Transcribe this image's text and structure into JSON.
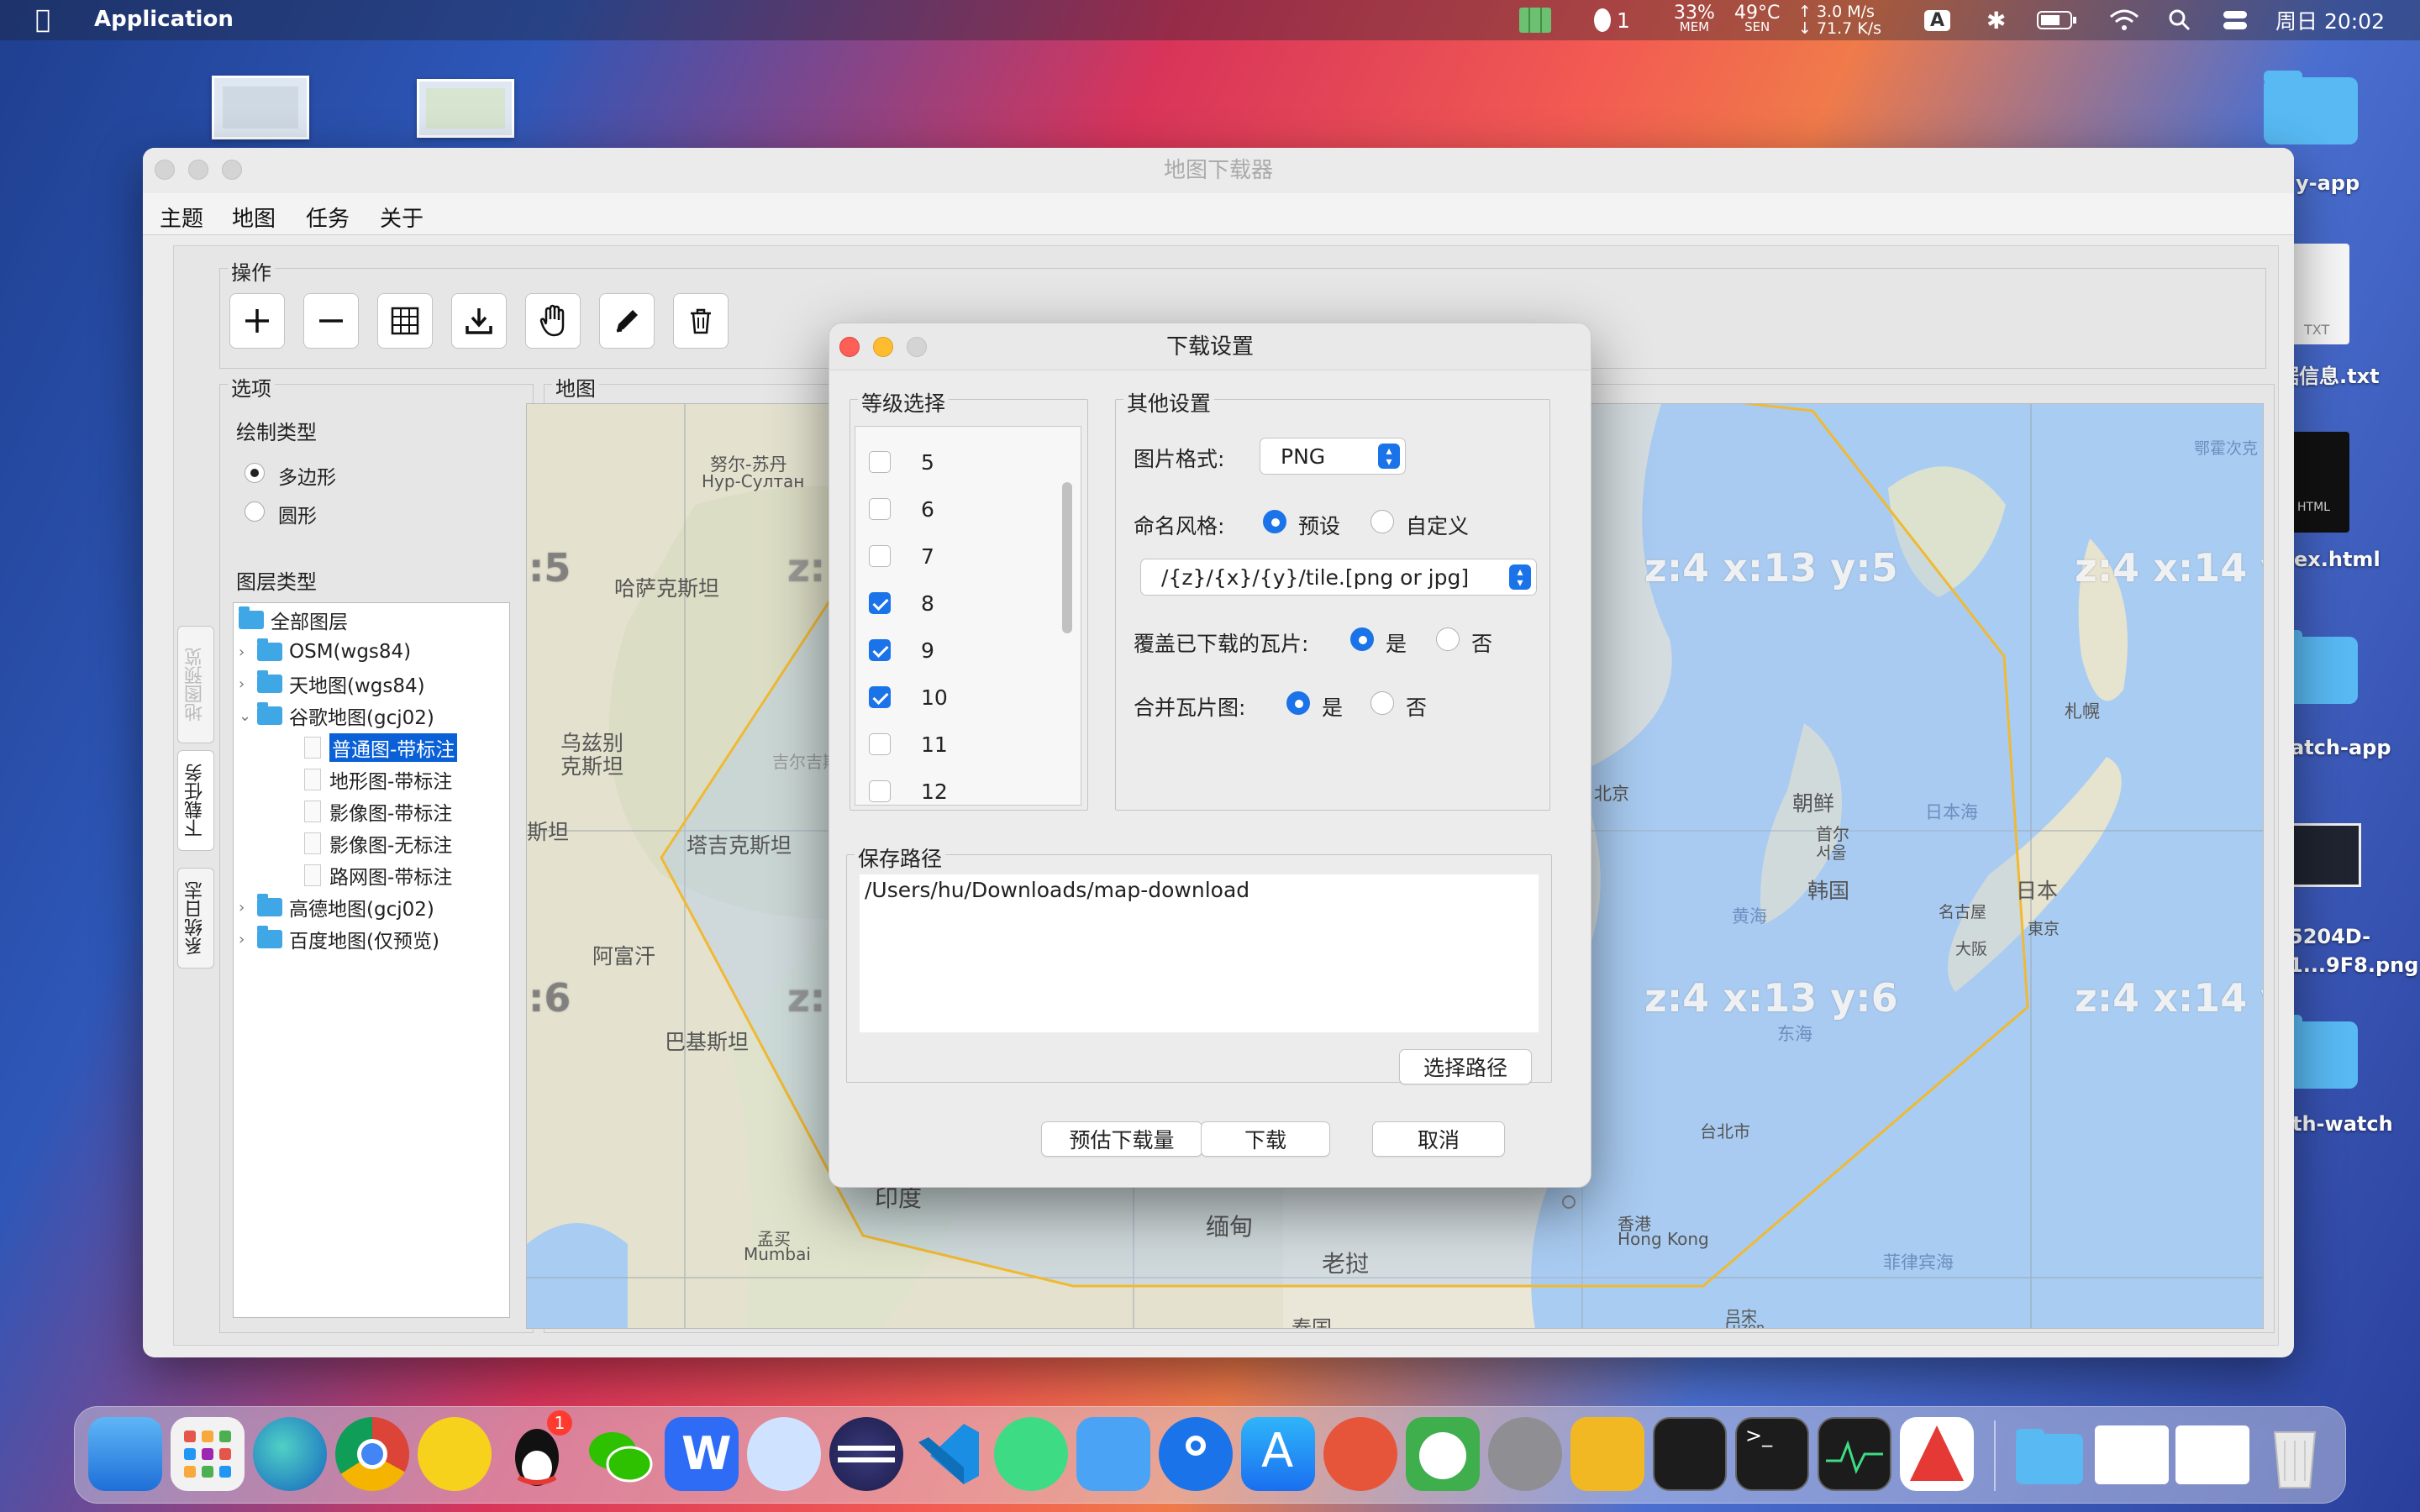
{
  "menubar": {
    "app_name": "Application",
    "mem": "33%",
    "mem_label": "MEM",
    "temp": "49°C",
    "temp_label": "SEN",
    "net_up": "3.0 M/s",
    "net_down": "71.7 K/s",
    "qq_count": "1",
    "input_method": "A",
    "clock": "周日 20:02"
  },
  "desktop": {
    "items": [
      {
        "label": "y-app"
      },
      {
        "label": "据信息.txt",
        "badge": "TXT"
      },
      {
        "label": "ex.html",
        "badge": "HTML"
      },
      {
        "label": "atch-app"
      },
      {
        "label": "5204D-\n1...9F8.png"
      },
      {
        "label": "th-watch"
      }
    ]
  },
  "window": {
    "title": "地图下载器",
    "menu": [
      "主题",
      "地图",
      "任务",
      "关于"
    ],
    "ops_label": "操作",
    "options_label": "选项",
    "map_label": "地图",
    "draw_type_label": "绘制类型",
    "draw_types": [
      "多边形",
      "圆形"
    ],
    "layer_type_label": "图层类型",
    "side_tabs": [
      "地图预览",
      "下载任务",
      "系统日志"
    ],
    "tree": {
      "root": "全部图层",
      "groups": [
        {
          "label": "OSM(wgs84)"
        },
        {
          "label": "天地图(wgs84)"
        },
        {
          "label": "谷歌地图(gcj02)",
          "children": [
            "普通图-带标注",
            "地形图-带标注",
            "影像图-带标注",
            "影像图-无标注",
            "路网图-带标注"
          ]
        },
        {
          "label": "高德地图(gcj02)"
        },
        {
          "label": "百度地图(仅预览)"
        }
      ]
    }
  },
  "map": {
    "tiles": [
      "z:4 x:13 y:5",
      "z:4 x:14 y:",
      "z:4 x:13 y:6",
      "z:4 x:14 y:"
    ],
    "edge_labels": [
      ":5",
      ":6",
      "z:",
      "z:"
    ],
    "places": [
      "努尔-苏丹",
      "Нур-Султан",
      "哈萨克斯坦",
      "乌兹别克斯坦",
      "吉尔吉斯",
      "塔吉克斯坦",
      "斯坦",
      "阿富汗",
      "巴基斯坦",
      "印度",
      "孟买",
      "Mumbai",
      "缅甸",
      "老挝",
      "泰国",
      "朝鲜",
      "首尔",
      "서울",
      "韩国",
      "日本海",
      "日本",
      "東京",
      "名古屋",
      "大阪",
      "札幌",
      "黄海",
      "东海",
      "台北市",
      "香港",
      "Hong Kong",
      "菲律宾海",
      "北京",
      "鄂霍次克",
      "吕宋",
      "Luzon"
    ]
  },
  "dialog": {
    "title": "下载设置",
    "level_label": "等级选择",
    "levels": [
      {
        "level": "5",
        "checked": false
      },
      {
        "level": "6",
        "checked": false
      },
      {
        "level": "7",
        "checked": false
      },
      {
        "level": "8",
        "checked": true
      },
      {
        "level": "9",
        "checked": true
      },
      {
        "level": "10",
        "checked": true
      },
      {
        "level": "11",
        "checked": false
      },
      {
        "level": "12",
        "checked": false
      }
    ],
    "other_label": "其他设置",
    "format_label": "图片格式:",
    "format_value": "PNG",
    "naming_label": "命名风格:",
    "naming_preset": "预设",
    "naming_custom": "自定义",
    "naming_pattern": "/{z}/{x}/{y}/tile.[png or jpg]",
    "overwrite_label": "覆盖已下载的瓦片:",
    "merge_label": "合并瓦片图:",
    "yes": "是",
    "no": "否",
    "save_label": "保存路径",
    "save_path": "/Users/hu/Downloads/map-download",
    "choose_path": "选择路径",
    "estimate": "预估下载量",
    "download": "下载",
    "cancel": "取消"
  },
  "dock": {
    "qq_badge": "1",
    "icons": [
      "finder-icon",
      "launchpad-icon",
      "edge-icon",
      "chrome-icon",
      "music-icon",
      "qq-icon",
      "wechat-icon",
      "wps-icon",
      "swift-icon",
      "eclipse-icon",
      "vscode-icon",
      "android-studio-icon",
      "xcode-icon",
      "maps-pin-icon",
      "app-store-icon",
      "remote-desktop-icon",
      "panda-icon",
      "system-preferences-icon",
      "forklift-icon",
      "zen-terminal-icon",
      "terminal-icon",
      "activity-monitor-icon",
      "java-icon",
      "downloads-folder-icon",
      "window-preview-icon",
      "window-preview-icon-2",
      "trash-icon"
    ]
  }
}
